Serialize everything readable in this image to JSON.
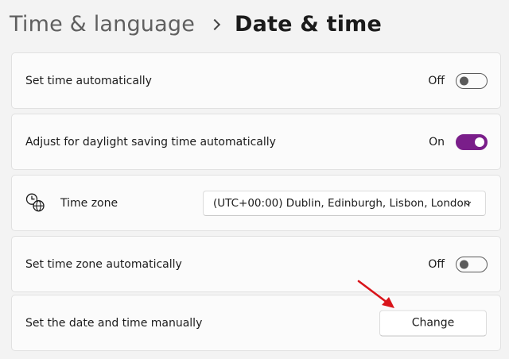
{
  "breadcrumb": {
    "parent": "Time & language",
    "current": "Date & time"
  },
  "settings": {
    "set_time_auto": {
      "label": "Set time automatically",
      "state": "Off"
    },
    "daylight_saving": {
      "label": "Adjust for daylight saving time automatically",
      "state": "On"
    },
    "time_zone": {
      "label": "Time zone",
      "value": "(UTC+00:00) Dublin, Edinburgh, Lisbon, London"
    },
    "set_tz_auto": {
      "label": "Set time zone automatically",
      "state": "Off"
    },
    "manual_date_time": {
      "label": "Set the date and time manually",
      "button": "Change"
    }
  },
  "colors": {
    "accent": "#7a1e8a",
    "annotation_arrow": "#d9151b"
  },
  "icons": {
    "time_zone": "clock-globe-icon",
    "dropdown": "chevron-down-icon",
    "annotation": "red-arrow-icon"
  }
}
